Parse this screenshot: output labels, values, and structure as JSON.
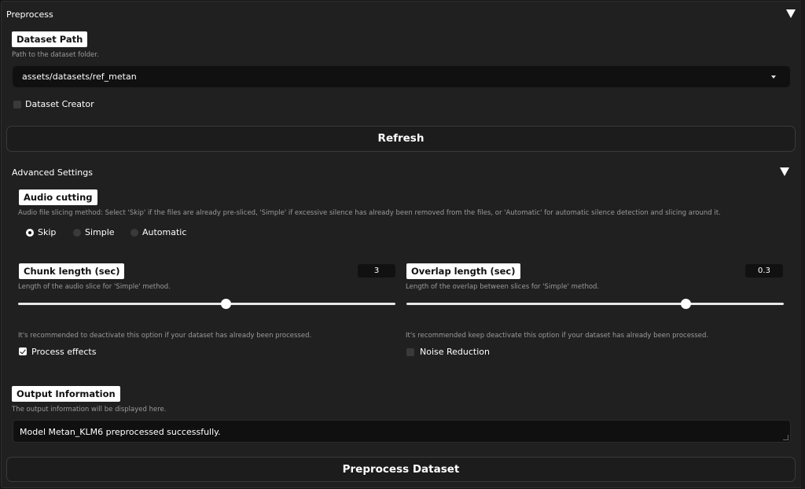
{
  "section": {
    "title": "Preprocess"
  },
  "dataset_path": {
    "label": "Dataset Path",
    "description": "Path to the dataset folder.",
    "value": "assets/datasets/ref_metan"
  },
  "dataset_creator": {
    "label": "Dataset Creator",
    "checked": false
  },
  "refresh": {
    "label": "Refresh"
  },
  "advanced": {
    "title": "Advanced Settings",
    "audio_cutting": {
      "label": "Audio cutting",
      "description": "Audio file slicing method: Select 'Skip' if the files are already pre-sliced, 'Simple' if excessive silence has already been removed from the files, or 'Automatic' for automatic silence detection and slicing around it.",
      "options": [
        "Skip",
        "Simple",
        "Automatic"
      ],
      "selected": "Skip"
    },
    "chunk_length": {
      "label": "Chunk length (sec)",
      "description": "Length of the audio slice for 'Simple' method.",
      "value": "3",
      "fraction": 0.55
    },
    "overlap_length": {
      "label": "Overlap length (sec)",
      "description": "Length of the overlap between slices for 'Simple' method.",
      "value": "0.3",
      "fraction": 0.74
    },
    "process_effects": {
      "hint": "It's recommended to deactivate this option if your dataset has already been processed.",
      "label": "Process effects",
      "checked": true
    },
    "noise_reduction": {
      "hint": "It's recommended keep deactivate this option if your dataset has already been processed.",
      "label": "Noise Reduction",
      "checked": false
    }
  },
  "output": {
    "label": "Output Information",
    "description": "The output information will be displayed here.",
    "value": "Model Metan_KLM6 preprocessed successfully."
  },
  "preprocess_button": {
    "label": "Preprocess Dataset"
  },
  "colors": {
    "background": "#202020",
    "accent": "#ffffff",
    "field": "#101010"
  }
}
